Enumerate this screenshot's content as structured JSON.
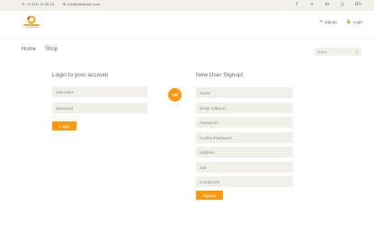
{
  "header": {
    "phone": "+2 0111 47 68 15",
    "email": "info@stellicoart.com",
    "socials": [
      "f",
      "t",
      "in",
      "dribbble",
      "G+"
    ],
    "social_icons": [
      "facebook-icon",
      "twitter-icon",
      "linkedin-icon",
      "dribbble-icon",
      "google-plus-icon"
    ],
    "signup_label": "Signup",
    "login_label": "Login",
    "logo_text": "stelli coart"
  },
  "nav": {
    "home": "Home",
    "shop": "Shop",
    "search_placeholder": "Search"
  },
  "login": {
    "title": "Login to your account",
    "username_placeholder": "username",
    "password_placeholder": "password",
    "button": "Login"
  },
  "or_label": "OR",
  "signup": {
    "title": "New User Signup!",
    "fields": [
      "Name",
      "Email Address",
      "Password",
      "ConfirmPassword",
      "Address",
      "Job",
      "CreditCard"
    ],
    "button": "Signup"
  },
  "colors": {
    "accent": "#fe980f",
    "field_bg": "#f0f0e9",
    "text": "#696763"
  }
}
